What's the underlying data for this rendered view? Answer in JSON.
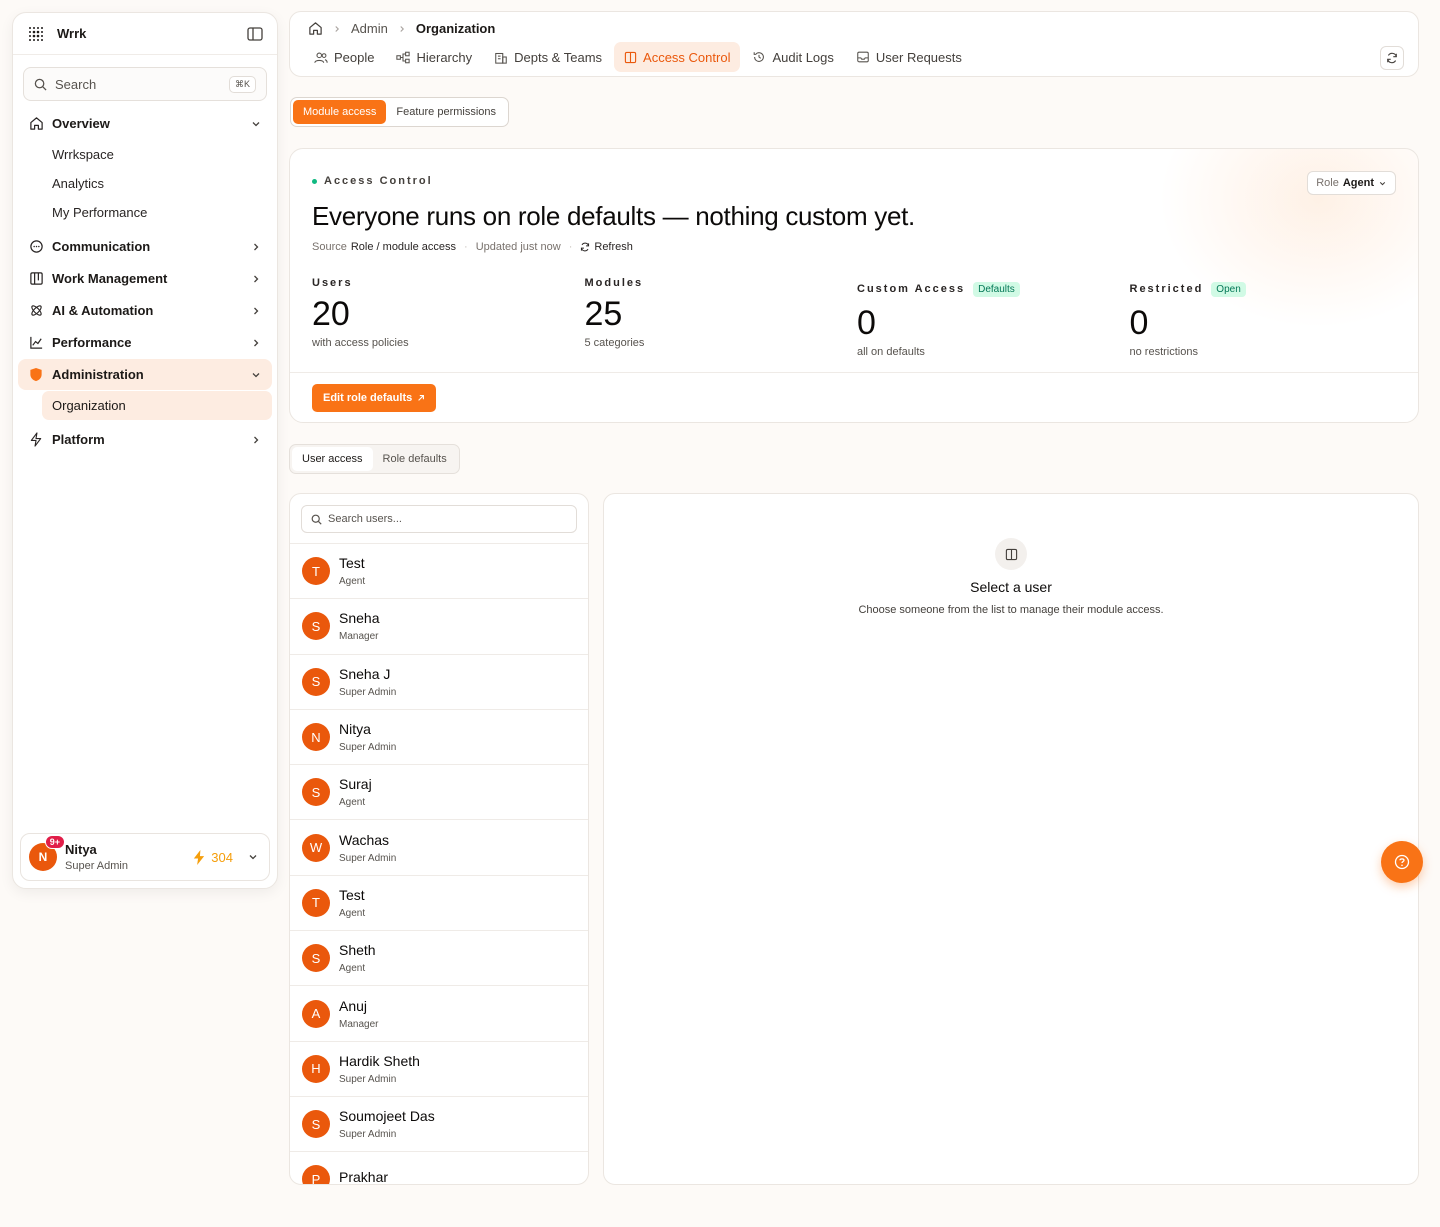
{
  "brand": "Wrrk",
  "sidebar": {
    "search_label": "Search",
    "search_shortcut": "⌘K",
    "overview_label": "Overview",
    "overview_items": [
      "Wrrkspace",
      "Analytics",
      "My Performance"
    ],
    "communication_label": "Communication",
    "work_management_label": "Work Management",
    "ai_automation_label": "AI & Automation",
    "performance_label": "Performance",
    "administration_label": "Administration",
    "administration_items": [
      "Organization"
    ],
    "platform_label": "Platform",
    "user": {
      "initial": "N",
      "badge": "9+",
      "name": "Nitya",
      "role": "Super Admin",
      "points": "304"
    }
  },
  "header": {
    "breadcrumb": [
      "Admin",
      "Organization"
    ],
    "tabs": [
      "People",
      "Hierarchy",
      "Depts & Teams",
      "Access Control",
      "Audit Logs",
      "User Requests"
    ],
    "active_tab": "Access Control"
  },
  "mode_toggle": {
    "options": [
      "Module access",
      "Feature permissions"
    ],
    "selected": "Module access"
  },
  "hero": {
    "eyebrow": "Access Control",
    "headline": "Everyone runs on role defaults — nothing custom yet.",
    "source_label": "Source",
    "source_value": "Role / module access",
    "updated": "Updated just now",
    "refresh": "Refresh",
    "role_label": "Role",
    "role_value": "Agent",
    "stats": [
      {
        "label": "Users",
        "value": "20",
        "sub": "with access policies"
      },
      {
        "label": "Modules",
        "value": "25",
        "sub": "5 categories"
      },
      {
        "label": "Custom Access",
        "badge": "Defaults",
        "value": "0",
        "sub": "all on defaults"
      },
      {
        "label": "Restricted",
        "badge": "Open",
        "value": "0",
        "sub": "no restrictions"
      }
    ],
    "edit_button": "Edit role defaults"
  },
  "access_toggle": {
    "options": [
      "User access",
      "Role defaults"
    ],
    "selected": "User access"
  },
  "user_search_placeholder": "Search users...",
  "users": [
    {
      "initial": "T",
      "name": "Test",
      "role": "Agent"
    },
    {
      "initial": "S",
      "name": "Sneha",
      "role": "Manager"
    },
    {
      "initial": "S",
      "name": "Sneha J",
      "role": "Super Admin"
    },
    {
      "initial": "N",
      "name": "Nitya",
      "role": "Super Admin"
    },
    {
      "initial": "S",
      "name": "Suraj",
      "role": "Agent"
    },
    {
      "initial": "W",
      "name": "Wachas",
      "role": "Super Admin"
    },
    {
      "initial": "T",
      "name": "Test",
      "role": "Agent"
    },
    {
      "initial": "S",
      "name": "Sheth",
      "role": "Agent"
    },
    {
      "initial": "A",
      "name": "Anuj",
      "role": "Manager"
    },
    {
      "initial": "H",
      "name": "Hardik Sheth",
      "role": "Super Admin"
    },
    {
      "initial": "S",
      "name": "Soumojeet Das",
      "role": "Super Admin"
    },
    {
      "initial": "P",
      "name": "Prakhar",
      "role": ""
    }
  ],
  "detail": {
    "title": "Select a user",
    "subtitle": "Choose someone from the list to manage their module access."
  },
  "colors": {
    "accent": "#f97316",
    "accent_soft": "#fdece1",
    "success": "#10b981"
  }
}
